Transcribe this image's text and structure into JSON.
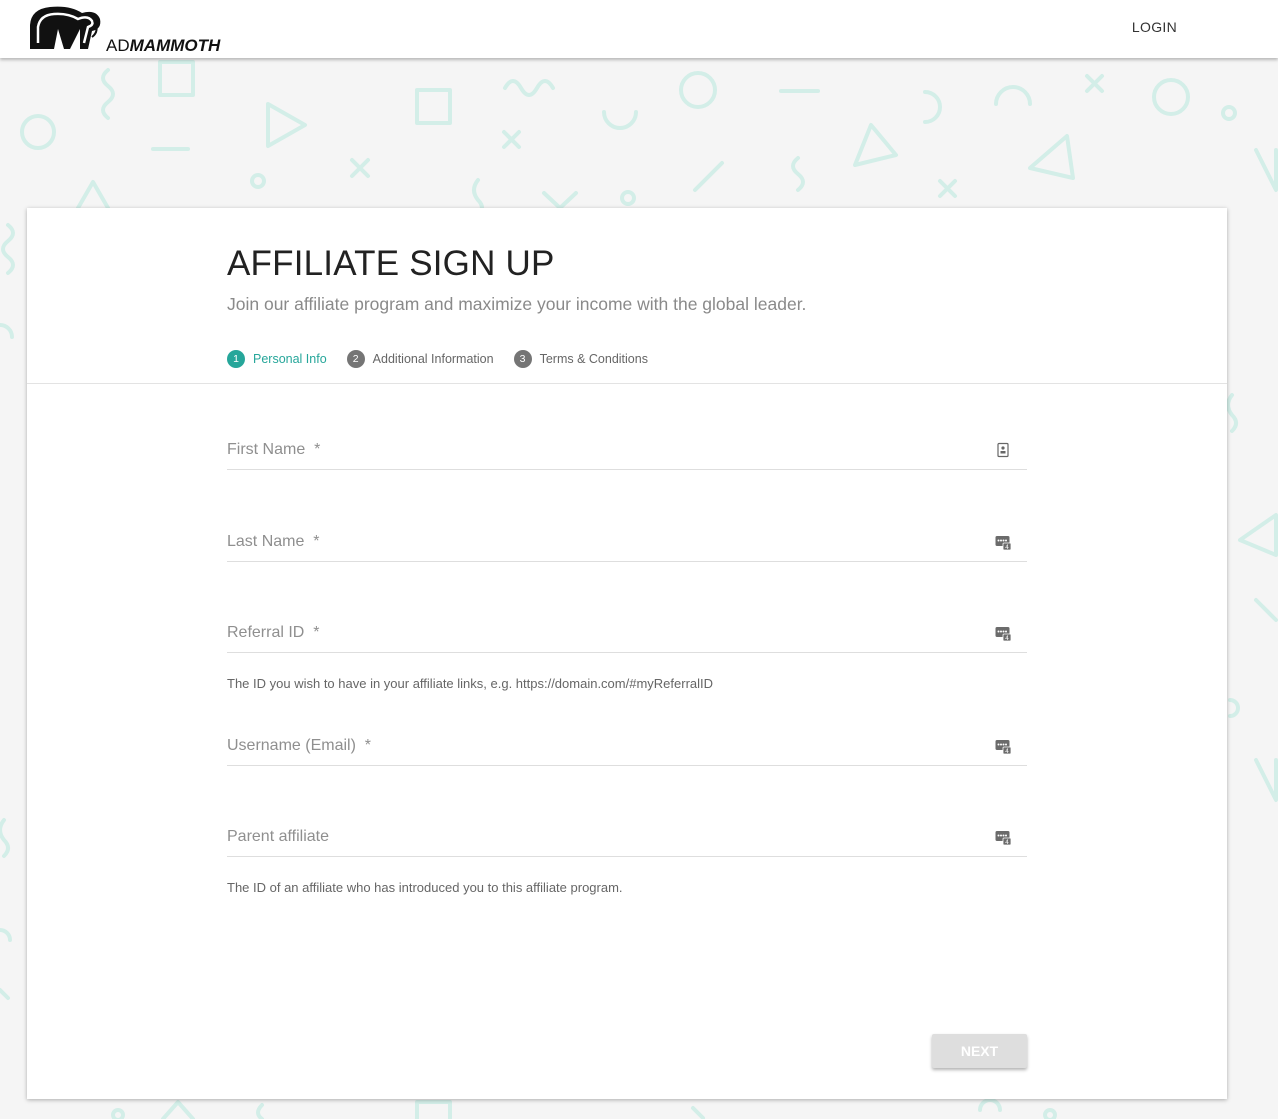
{
  "brand": {
    "logo_prefix": "AD",
    "logo_name": "MAMMOTH",
    "accent_color": "#26a69a",
    "pattern_color": "#d3eee8"
  },
  "nav": {
    "login_label": "LOGIN"
  },
  "page": {
    "title": "AFFILIATE SIGN UP",
    "subtitle": "Join our affiliate program and maximize your income with the global leader."
  },
  "steps": [
    {
      "number": "1",
      "label": "Personal Info",
      "active": true
    },
    {
      "number": "2",
      "label": "Additional Information",
      "active": false
    },
    {
      "number": "3",
      "label": "Terms & Conditions",
      "active": false
    }
  ],
  "form": {
    "first_name": {
      "placeholder": "First Name  *",
      "value": "",
      "icon": "contact-card-icon"
    },
    "last_name": {
      "placeholder": "Last Name  *",
      "value": "",
      "icon": "password-manager-icon"
    },
    "referral_id": {
      "placeholder": "Referral ID  *",
      "value": "",
      "icon": "password-manager-icon",
      "hint": "The ID you wish to have in your affiliate links, e.g. https://domain.com/#myReferralID"
    },
    "username": {
      "placeholder": "Username (Email)  *",
      "value": "",
      "icon": "password-manager-icon"
    },
    "parent_affiliate": {
      "placeholder": "Parent affiliate",
      "value": "",
      "icon": "password-manager-icon",
      "hint": "The ID of an affiliate who has introduced you to this affiliate program."
    }
  },
  "actions": {
    "next_label": "NEXT"
  }
}
